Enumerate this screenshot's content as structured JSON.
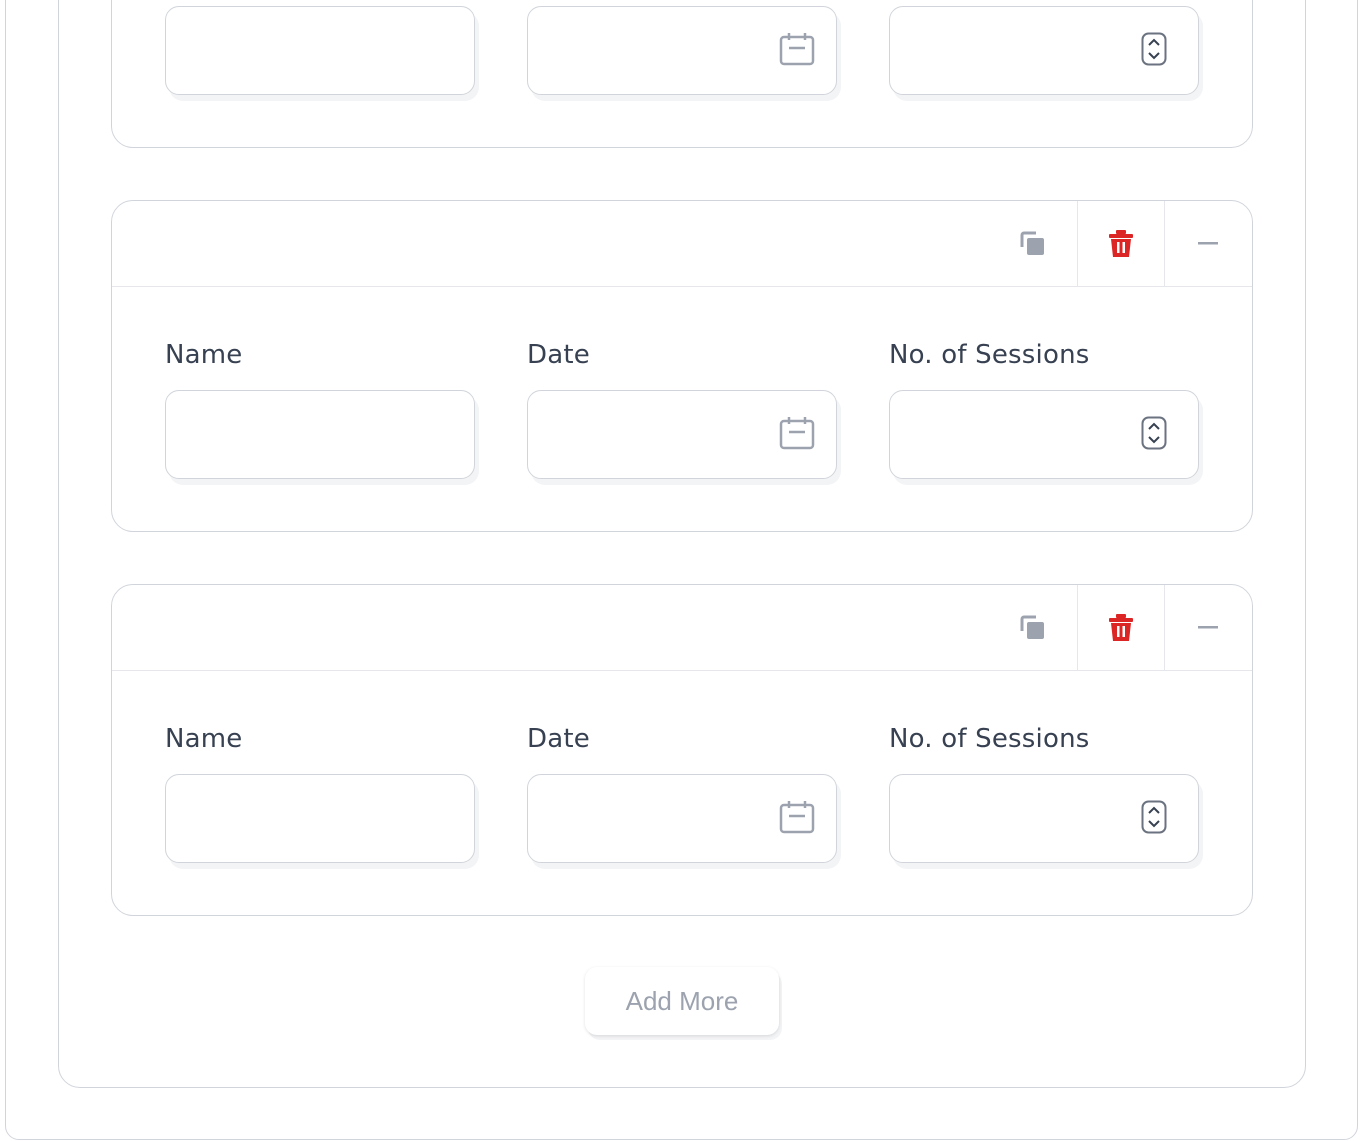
{
  "form": {
    "entries": [
      {
        "name_label": "",
        "date_label": "",
        "sessions_label": "",
        "name_value": "",
        "date_value": "",
        "sessions_value": ""
      },
      {
        "name_label": "Name",
        "date_label": "Date",
        "sessions_label": "No. of Sessions",
        "name_value": "",
        "date_value": "",
        "sessions_value": ""
      },
      {
        "name_label": "Name",
        "date_label": "Date",
        "sessions_label": "No. of Sessions",
        "name_value": "",
        "date_value": "",
        "sessions_value": ""
      }
    ],
    "add_more_label": "Add More"
  },
  "colors": {
    "delete_icon": "#dc2626",
    "muted_icon": "#9ca3af",
    "border": "#d1d5db"
  },
  "icons": {
    "copy": "copy-icon",
    "delete": "trash-icon",
    "collapse": "minus-icon",
    "date": "calendar-icon",
    "number": "stepper-icon"
  }
}
